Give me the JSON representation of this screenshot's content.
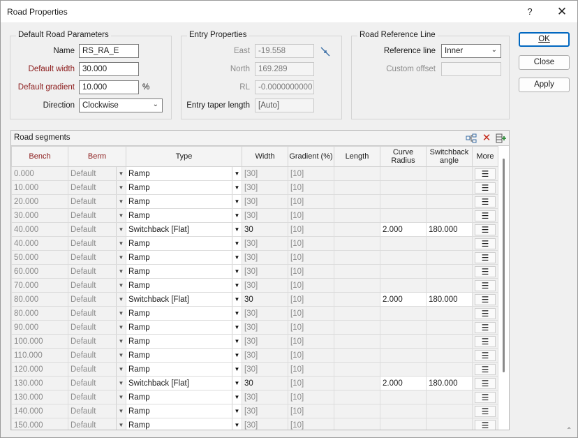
{
  "window": {
    "title": "Road Properties",
    "help_glyph": "?",
    "close_glyph": "✕"
  },
  "default_params": {
    "legend": "Default Road Parameters",
    "name_label": "Name",
    "name_value": "RS_RA_E",
    "width_label": "Default width",
    "width_value": "30.000",
    "gradient_label": "Default gradient",
    "gradient_value": "10.000",
    "gradient_unit": "%",
    "direction_label": "Direction",
    "direction_value": "Clockwise"
  },
  "entry": {
    "legend": "Entry Properties",
    "east_label": "East",
    "east_value": "-19.558",
    "north_label": "North",
    "north_value": "169.289",
    "rl_label": "RL",
    "rl_value": "-0.0000000000",
    "taper_label": "Entry taper length",
    "taper_value": "[Auto]"
  },
  "refline": {
    "legend": "Road Reference Line",
    "ref_label": "Reference line",
    "ref_value": "Inner",
    "offset_label": "Custom offset",
    "offset_value": ""
  },
  "buttons": {
    "ok": "OK",
    "close": "Close",
    "apply": "Apply"
  },
  "segments": {
    "title": "Road segments",
    "columns": [
      "Bench",
      "Berm",
      "Type",
      "Width",
      "Gradient (%)",
      "Length",
      "Curve Radius",
      "Switchback angle",
      "More"
    ],
    "rows": [
      {
        "bench": "0.000",
        "berm": "Default",
        "type": "Ramp",
        "width": "[30]",
        "gradient": "[10]",
        "length": "",
        "radius": "",
        "angle": ""
      },
      {
        "bench": "10.000",
        "berm": "Default",
        "type": "Ramp",
        "width": "[30]",
        "gradient": "[10]",
        "length": "",
        "radius": "",
        "angle": ""
      },
      {
        "bench": "20.000",
        "berm": "Default",
        "type": "Ramp",
        "width": "[30]",
        "gradient": "[10]",
        "length": "",
        "radius": "",
        "angle": ""
      },
      {
        "bench": "30.000",
        "berm": "Default",
        "type": "Ramp",
        "width": "[30]",
        "gradient": "[10]",
        "length": "",
        "radius": "",
        "angle": ""
      },
      {
        "bench": "40.000",
        "berm": "Default",
        "type": "Switchback [Flat]",
        "width": "30",
        "gradient": "[10]",
        "length": "",
        "radius": "2.000",
        "angle": "180.000"
      },
      {
        "bench": "40.000",
        "berm": "Default",
        "type": "Ramp",
        "width": "[30]",
        "gradient": "[10]",
        "length": "",
        "radius": "",
        "angle": ""
      },
      {
        "bench": "50.000",
        "berm": "Default",
        "type": "Ramp",
        "width": "[30]",
        "gradient": "[10]",
        "length": "",
        "radius": "",
        "angle": ""
      },
      {
        "bench": "60.000",
        "berm": "Default",
        "type": "Ramp",
        "width": "[30]",
        "gradient": "[10]",
        "length": "",
        "radius": "",
        "angle": ""
      },
      {
        "bench": "70.000",
        "berm": "Default",
        "type": "Ramp",
        "width": "[30]",
        "gradient": "[10]",
        "length": "",
        "radius": "",
        "angle": ""
      },
      {
        "bench": "80.000",
        "berm": "Default",
        "type": "Switchback [Flat]",
        "width": "30",
        "gradient": "[10]",
        "length": "",
        "radius": "2.000",
        "angle": "180.000"
      },
      {
        "bench": "80.000",
        "berm": "Default",
        "type": "Ramp",
        "width": "[30]",
        "gradient": "[10]",
        "length": "",
        "radius": "",
        "angle": ""
      },
      {
        "bench": "90.000",
        "berm": "Default",
        "type": "Ramp",
        "width": "[30]",
        "gradient": "[10]",
        "length": "",
        "radius": "",
        "angle": ""
      },
      {
        "bench": "100.000",
        "berm": "Default",
        "type": "Ramp",
        "width": "[30]",
        "gradient": "[10]",
        "length": "",
        "radius": "",
        "angle": ""
      },
      {
        "bench": "110.000",
        "berm": "Default",
        "type": "Ramp",
        "width": "[30]",
        "gradient": "[10]",
        "length": "",
        "radius": "",
        "angle": ""
      },
      {
        "bench": "120.000",
        "berm": "Default",
        "type": "Ramp",
        "width": "[30]",
        "gradient": "[10]",
        "length": "",
        "radius": "",
        "angle": ""
      },
      {
        "bench": "130.000",
        "berm": "Default",
        "type": "Switchback [Flat]",
        "width": "30",
        "gradient": "[10]",
        "length": "",
        "radius": "2.000",
        "angle": "180.000"
      },
      {
        "bench": "130.000",
        "berm": "Default",
        "type": "Ramp",
        "width": "[30]",
        "gradient": "[10]",
        "length": "",
        "radius": "",
        "angle": ""
      },
      {
        "bench": "140.000",
        "berm": "Default",
        "type": "Ramp",
        "width": "[30]",
        "gradient": "[10]",
        "length": "",
        "radius": "",
        "angle": ""
      },
      {
        "bench": "150.000",
        "berm": "Default",
        "type": "Ramp",
        "width": "[30]",
        "gradient": "[10]",
        "length": "",
        "radius": "",
        "angle": ""
      }
    ]
  },
  "icons": {
    "help": "help-icon",
    "close": "close-icon",
    "pick": "pick-point-icon",
    "chevron": "chevron-down-icon",
    "tree": "tree-structure-icon",
    "delete": "delete-icon",
    "add_row": "add-row-icon",
    "menu": "menu-icon"
  },
  "colors": {
    "required_label": "#8b1a1a",
    "default_button": "#0067c0",
    "delete_icon": "#c42b1c",
    "add_icon": "#2e8b3a"
  }
}
